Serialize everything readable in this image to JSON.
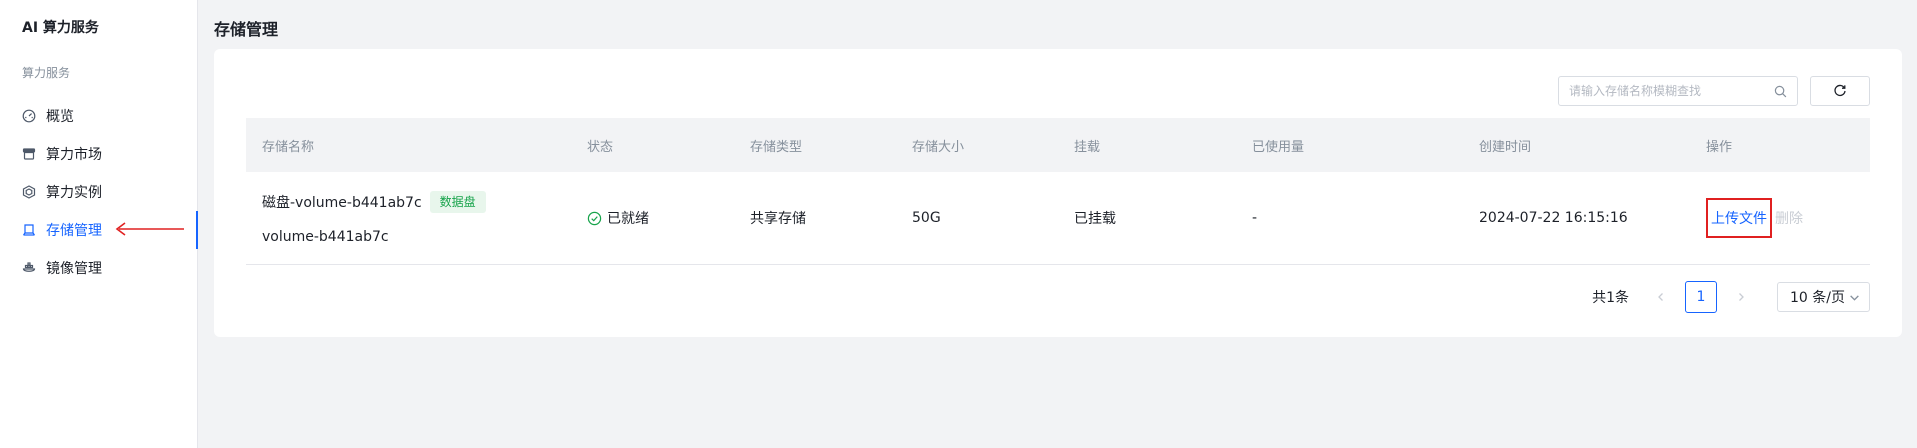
{
  "app": {
    "title": "AI 算力服务"
  },
  "sidebar": {
    "section_label": "算力服务",
    "items": [
      {
        "label": "概览",
        "icon": "dashboard-icon",
        "active": false
      },
      {
        "label": "算力市场",
        "icon": "store-icon",
        "active": false
      },
      {
        "label": "算力实例",
        "icon": "instance-icon",
        "active": false
      },
      {
        "label": "存储管理",
        "icon": "storage-icon",
        "active": true
      },
      {
        "label": "镜像管理",
        "icon": "image-icon",
        "active": false
      }
    ]
  },
  "page": {
    "title": "存储管理"
  },
  "toolbar": {
    "search_placeholder": "请输入存储名称模糊查找"
  },
  "table": {
    "columns": [
      "存储名称",
      "状态",
      "存储类型",
      "存储大小",
      "挂载",
      "已使用量",
      "创建时间",
      "操作"
    ],
    "rows": [
      {
        "name": "磁盘-volume-b441ab7c",
        "tag": "数据盘",
        "sub_name": "volume-b441ab7c",
        "status": "已就绪",
        "type": "共享存储",
        "size": "50G",
        "mount": "已挂载",
        "used": "-",
        "created": "2024-07-22 16:15:16",
        "actions": {
          "upload": "上传文件",
          "delete": "删除"
        }
      }
    ]
  },
  "pagination": {
    "total": "共1条",
    "current": "1",
    "page_size": "10 条/页"
  },
  "colors": {
    "accent": "#1664ff",
    "success": "#16a34a",
    "annotation": "#e02020"
  }
}
